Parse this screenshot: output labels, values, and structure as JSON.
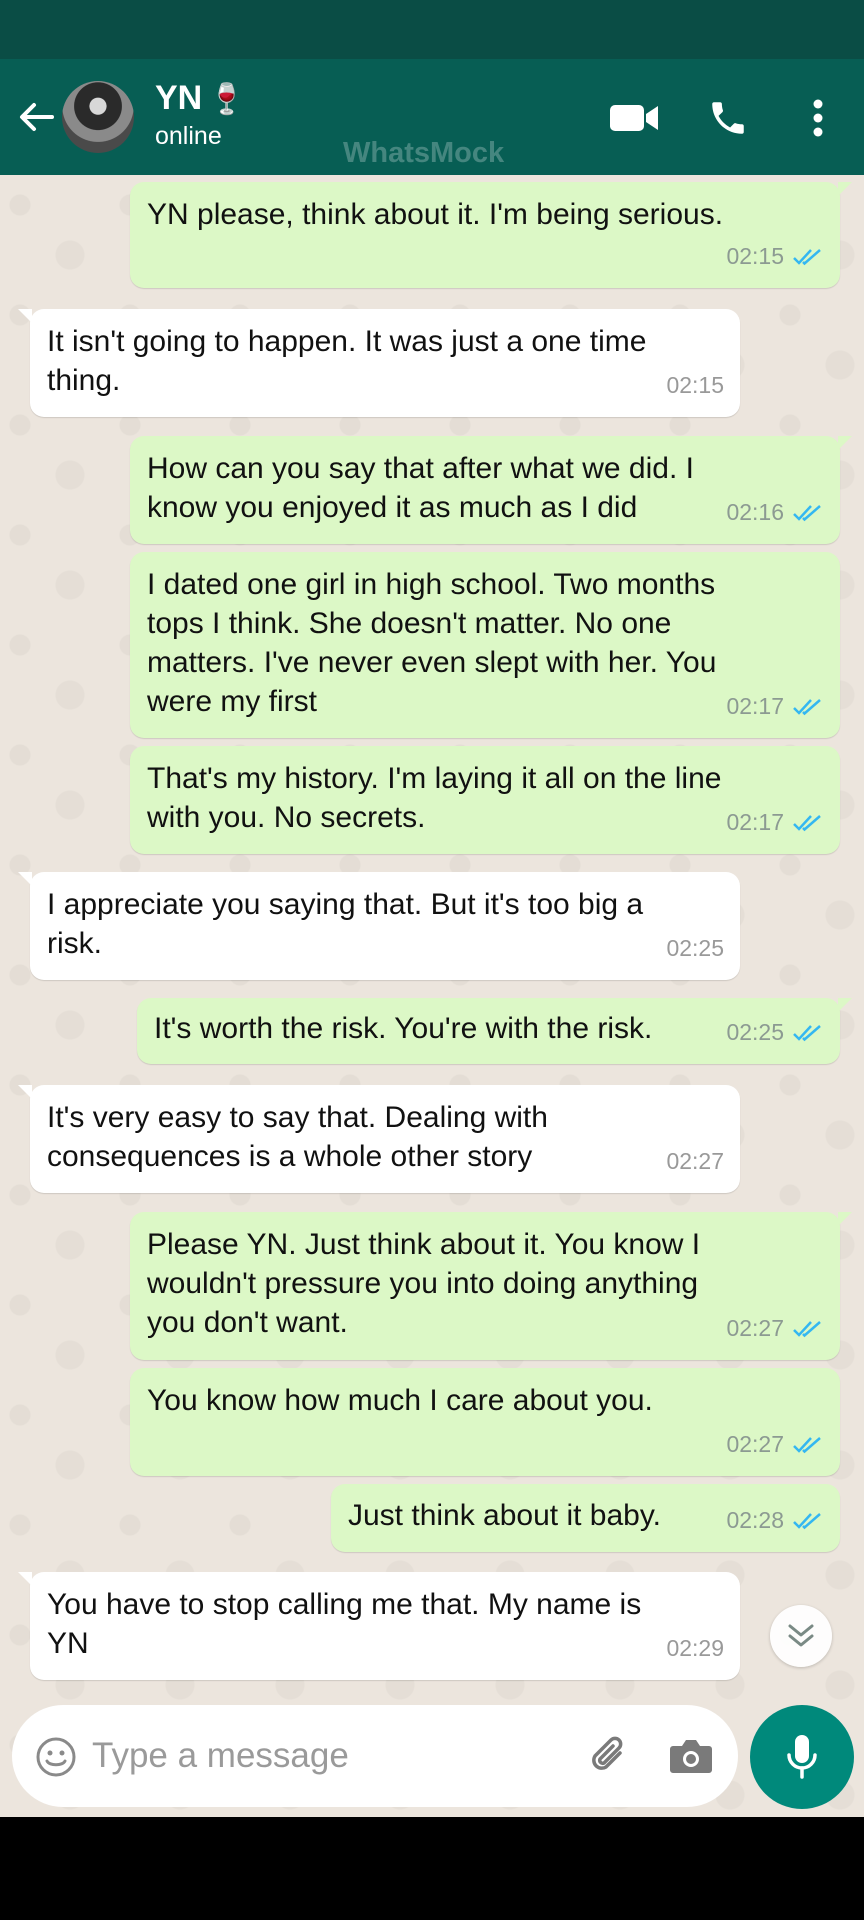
{
  "header": {
    "contact_name": "YN",
    "name_emoji": "🍷",
    "status": "online",
    "watermark": "WhatsMock",
    "icons": [
      "back-arrow-icon",
      "video-call-icon",
      "voice-call-icon",
      "more-options-icon"
    ]
  },
  "colors": {
    "header": "#075e54",
    "status_bar": "#0a4d45",
    "outgoing_bubble": "#dcf8c6",
    "incoming_bubble": "#ffffff",
    "chat_background": "#ece5dd",
    "read_ticks": "#34b7f1",
    "mic_button": "#00897b"
  },
  "messages": [
    {
      "direction": "out",
      "text": "YN please, think about it. I'm being serious.",
      "time": "02:15",
      "read": true
    },
    {
      "direction": "in",
      "text": "It isn't going to happen. It was just a one time\nthing.",
      "time": "02:15"
    },
    {
      "direction": "out",
      "text": "How can you say that after what we did. I\nknow you enjoyed it as much as I did",
      "time": "02:16",
      "read": true
    },
    {
      "direction": "out",
      "text": "I dated one girl in high school. Two months\ntops I think. She doesn't matter. No one\nmatters. I've never even slept with her. You\nwere my first",
      "time": "02:17",
      "read": true
    },
    {
      "direction": "out",
      "text": "That's my history. I'm laying it all on the line\nwith you. No secrets.",
      "time": "02:17",
      "read": true
    },
    {
      "direction": "in",
      "text": "I appreciate you saying that. But it's too big a\nrisk.",
      "time": "02:25"
    },
    {
      "direction": "out",
      "text": "It's worth the risk. You're with the risk.",
      "time": "02:25",
      "read": true
    },
    {
      "direction": "in",
      "text": "It's very easy to say that. Dealing with\nconsequences is a whole other story",
      "time": "02:27"
    },
    {
      "direction": "out",
      "text": "Please YN. Just think about it. You know I\nwouldn't pressure you into doing anything\nyou don't want.",
      "time": "02:27",
      "read": true
    },
    {
      "direction": "out",
      "text": "You know how much I care about you.",
      "time": "02:27",
      "read": true
    },
    {
      "direction": "out",
      "text": "Just think about it baby.",
      "time": "02:28",
      "read": true
    },
    {
      "direction": "in",
      "text": "You have to stop calling me that. My name is\nYN",
      "time": "02:29"
    }
  ],
  "input": {
    "placeholder": "Type a message",
    "value": ""
  }
}
